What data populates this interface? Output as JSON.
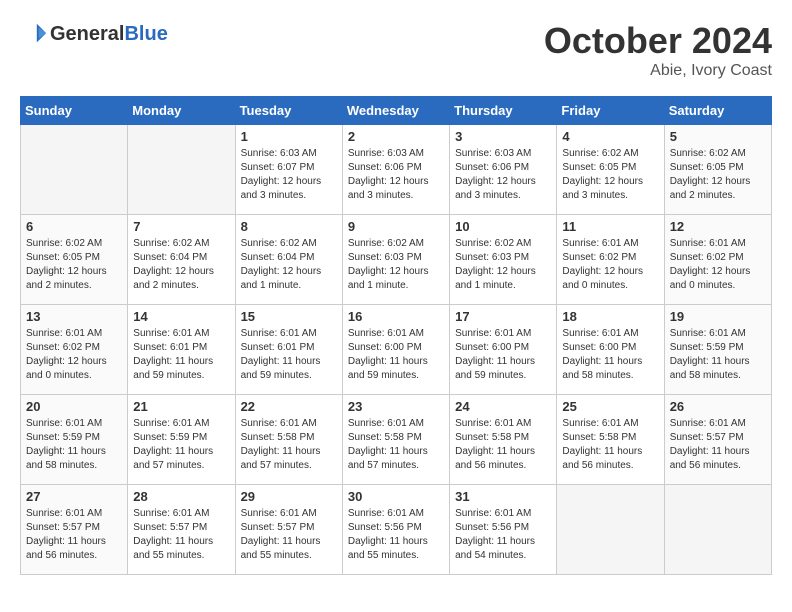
{
  "header": {
    "logo_line1": "General",
    "logo_line2": "Blue",
    "month": "October 2024",
    "location": "Abie, Ivory Coast"
  },
  "days_of_week": [
    "Sunday",
    "Monday",
    "Tuesday",
    "Wednesday",
    "Thursday",
    "Friday",
    "Saturday"
  ],
  "weeks": [
    [
      {
        "day": "",
        "info": ""
      },
      {
        "day": "",
        "info": ""
      },
      {
        "day": "1",
        "info": "Sunrise: 6:03 AM\nSunset: 6:07 PM\nDaylight: 12 hours\nand 3 minutes."
      },
      {
        "day": "2",
        "info": "Sunrise: 6:03 AM\nSunset: 6:06 PM\nDaylight: 12 hours\nand 3 minutes."
      },
      {
        "day": "3",
        "info": "Sunrise: 6:03 AM\nSunset: 6:06 PM\nDaylight: 12 hours\nand 3 minutes."
      },
      {
        "day": "4",
        "info": "Sunrise: 6:02 AM\nSunset: 6:05 PM\nDaylight: 12 hours\nand 3 minutes."
      },
      {
        "day": "5",
        "info": "Sunrise: 6:02 AM\nSunset: 6:05 PM\nDaylight: 12 hours\nand 2 minutes."
      }
    ],
    [
      {
        "day": "6",
        "info": "Sunrise: 6:02 AM\nSunset: 6:05 PM\nDaylight: 12 hours\nand 2 minutes."
      },
      {
        "day": "7",
        "info": "Sunrise: 6:02 AM\nSunset: 6:04 PM\nDaylight: 12 hours\nand 2 minutes."
      },
      {
        "day": "8",
        "info": "Sunrise: 6:02 AM\nSunset: 6:04 PM\nDaylight: 12 hours\nand 1 minute."
      },
      {
        "day": "9",
        "info": "Sunrise: 6:02 AM\nSunset: 6:03 PM\nDaylight: 12 hours\nand 1 minute."
      },
      {
        "day": "10",
        "info": "Sunrise: 6:02 AM\nSunset: 6:03 PM\nDaylight: 12 hours\nand 1 minute."
      },
      {
        "day": "11",
        "info": "Sunrise: 6:01 AM\nSunset: 6:02 PM\nDaylight: 12 hours\nand 0 minutes."
      },
      {
        "day": "12",
        "info": "Sunrise: 6:01 AM\nSunset: 6:02 PM\nDaylight: 12 hours\nand 0 minutes."
      }
    ],
    [
      {
        "day": "13",
        "info": "Sunrise: 6:01 AM\nSunset: 6:02 PM\nDaylight: 12 hours\nand 0 minutes."
      },
      {
        "day": "14",
        "info": "Sunrise: 6:01 AM\nSunset: 6:01 PM\nDaylight: 11 hours\nand 59 minutes."
      },
      {
        "day": "15",
        "info": "Sunrise: 6:01 AM\nSunset: 6:01 PM\nDaylight: 11 hours\nand 59 minutes."
      },
      {
        "day": "16",
        "info": "Sunrise: 6:01 AM\nSunset: 6:00 PM\nDaylight: 11 hours\nand 59 minutes."
      },
      {
        "day": "17",
        "info": "Sunrise: 6:01 AM\nSunset: 6:00 PM\nDaylight: 11 hours\nand 59 minutes."
      },
      {
        "day": "18",
        "info": "Sunrise: 6:01 AM\nSunset: 6:00 PM\nDaylight: 11 hours\nand 58 minutes."
      },
      {
        "day": "19",
        "info": "Sunrise: 6:01 AM\nSunset: 5:59 PM\nDaylight: 11 hours\nand 58 minutes."
      }
    ],
    [
      {
        "day": "20",
        "info": "Sunrise: 6:01 AM\nSunset: 5:59 PM\nDaylight: 11 hours\nand 58 minutes."
      },
      {
        "day": "21",
        "info": "Sunrise: 6:01 AM\nSunset: 5:59 PM\nDaylight: 11 hours\nand 57 minutes."
      },
      {
        "day": "22",
        "info": "Sunrise: 6:01 AM\nSunset: 5:58 PM\nDaylight: 11 hours\nand 57 minutes."
      },
      {
        "day": "23",
        "info": "Sunrise: 6:01 AM\nSunset: 5:58 PM\nDaylight: 11 hours\nand 57 minutes."
      },
      {
        "day": "24",
        "info": "Sunrise: 6:01 AM\nSunset: 5:58 PM\nDaylight: 11 hours\nand 56 minutes."
      },
      {
        "day": "25",
        "info": "Sunrise: 6:01 AM\nSunset: 5:58 PM\nDaylight: 11 hours\nand 56 minutes."
      },
      {
        "day": "26",
        "info": "Sunrise: 6:01 AM\nSunset: 5:57 PM\nDaylight: 11 hours\nand 56 minutes."
      }
    ],
    [
      {
        "day": "27",
        "info": "Sunrise: 6:01 AM\nSunset: 5:57 PM\nDaylight: 11 hours\nand 56 minutes."
      },
      {
        "day": "28",
        "info": "Sunrise: 6:01 AM\nSunset: 5:57 PM\nDaylight: 11 hours\nand 55 minutes."
      },
      {
        "day": "29",
        "info": "Sunrise: 6:01 AM\nSunset: 5:57 PM\nDaylight: 11 hours\nand 55 minutes."
      },
      {
        "day": "30",
        "info": "Sunrise: 6:01 AM\nSunset: 5:56 PM\nDaylight: 11 hours\nand 55 minutes."
      },
      {
        "day": "31",
        "info": "Sunrise: 6:01 AM\nSunset: 5:56 PM\nDaylight: 11 hours\nand 54 minutes."
      },
      {
        "day": "",
        "info": ""
      },
      {
        "day": "",
        "info": ""
      }
    ]
  ]
}
